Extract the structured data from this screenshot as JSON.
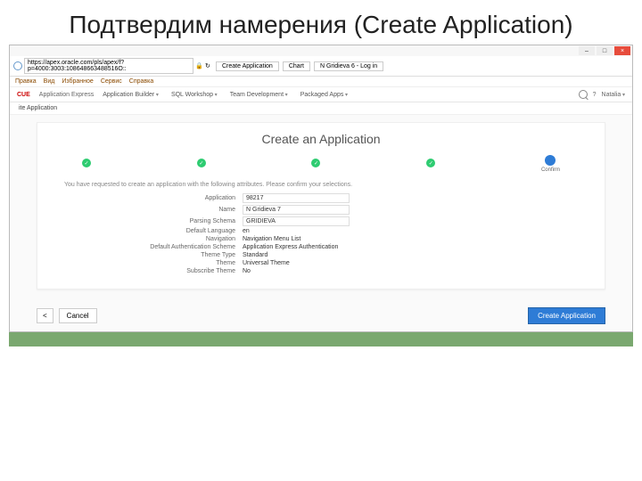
{
  "slide": {
    "title": "Подтвердим намерения (Create Application)"
  },
  "browser": {
    "url": "https://apex.oracle.com/pls/apex/f?p=4000:3003:108648663488516O::",
    "tabs": [
      "Create Application",
      "Chart",
      "N Gridieva 6 - Log in"
    ],
    "menu": [
      "Правка",
      "Вид",
      "Избранное",
      "Сервис",
      "Справка"
    ]
  },
  "apex": {
    "brand_red": "CUE",
    "brand_sub": "Application Express",
    "nav": [
      "Application Builder",
      "SQL Workshop",
      "Team Development",
      "Packaged Apps"
    ],
    "user": "Natalia",
    "breadcrumb": "ite Application"
  },
  "wizard": {
    "heading": "Create an Application",
    "steps": [
      "",
      "",
      "",
      "",
      "Confirm"
    ],
    "intro": "You have requested to create an application with the following attributes. Please confirm your selections.",
    "fields": [
      {
        "label": "Application",
        "value": "98217",
        "input": true
      },
      {
        "label": "Name",
        "value": "N Gridieva 7",
        "input": true
      },
      {
        "label": "Parsing Schema",
        "value": "GRIDIEVA",
        "input": true
      },
      {
        "label": "Default Language",
        "value": "en"
      },
      {
        "label": "Navigation",
        "value": "Navigation Menu List"
      },
      {
        "label": "Default Authentication Scheme",
        "value": "Application Express Authentication"
      },
      {
        "label": "Theme Type",
        "value": "Standard"
      },
      {
        "label": "Theme",
        "value": "Universal Theme"
      },
      {
        "label": "Subscribe Theme",
        "value": "No"
      }
    ],
    "back_icon": "<",
    "cancel": "Cancel",
    "submit": "Create Application"
  }
}
